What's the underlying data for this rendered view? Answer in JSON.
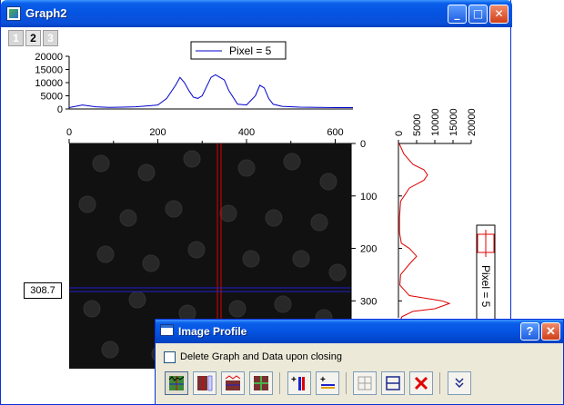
{
  "window": {
    "title": "Graph2",
    "controls": {
      "minimize": "minimize-icon",
      "maximize": "maximize-icon",
      "close": "close-icon"
    },
    "layer_tabs": [
      "1",
      "2",
      "3"
    ],
    "active_layer": "2"
  },
  "legend": {
    "label": "Pixel = 5"
  },
  "vertical_legend": {
    "label": "Pixel = 5"
  },
  "readout": {
    "value": "308.7"
  },
  "dialog": {
    "title": "Image Profile",
    "help_label": "?",
    "checkbox_label": "Delete Graph and Data upon closing",
    "checkbox_checked": false,
    "tools": [
      "horizontal-vertical-profile-icon",
      "vertical-profile-icon",
      "horizontal-profile-icon",
      "crosshair-profile-icon",
      "add-vertical-line-icon",
      "add-horizontal-line-icon",
      "arbitrary-line-icon",
      "horizontal-bar-icon",
      "delete-line-icon",
      "expand-chevron-icon"
    ]
  },
  "colors": {
    "profile_line": "#0000cc",
    "side_profile": "#e00000",
    "cursor_vertical": "#e00000",
    "cursor_horizontal": "#2020d0",
    "image_background": "#111111"
  },
  "chart_data": [
    {
      "type": "line",
      "name": "horizontal-profile",
      "series": [
        {
          "name": "Pixel = 5"
        }
      ],
      "xlim": [
        0,
        640
      ],
      "ylim": [
        0,
        20000
      ],
      "x_ticks": [
        "0",
        "200",
        "400",
        "600"
      ],
      "y_ticks": [
        "0",
        "5000",
        "10000",
        "15000",
        "20000"
      ],
      "x": [
        0,
        30,
        60,
        90,
        120,
        150,
        180,
        200,
        220,
        240,
        250,
        260,
        270,
        280,
        290,
        300,
        320,
        330,
        340,
        350,
        360,
        380,
        400,
        420,
        430,
        440,
        450,
        460,
        480,
        520,
        560,
        600,
        640
      ],
      "y": [
        500,
        1500,
        800,
        600,
        700,
        800,
        1200,
        1500,
        4000,
        9000,
        12000,
        10000,
        7000,
        4500,
        4000,
        5000,
        12000,
        13000,
        12000,
        11000,
        7000,
        1800,
        1500,
        5000,
        9000,
        8000,
        4000,
        1800,
        1000,
        700,
        600,
        500,
        500
      ]
    },
    {
      "type": "line",
      "name": "vertical-profile",
      "series": [
        {
          "name": "Pixel = 5"
        }
      ],
      "xlim": [
        0,
        20000
      ],
      "ylim": [
        0,
        360
      ],
      "x_ticks": [
        "0",
        "5000",
        "10000",
        "15000",
        "20000"
      ],
      "y_ticks": [
        "0",
        "100",
        "200",
        "300"
      ],
      "x": [
        200,
        1500,
        4000,
        7000,
        8000,
        7000,
        3000,
        600,
        300,
        300,
        800,
        3000,
        5000,
        3000,
        600,
        400,
        3000,
        12000,
        14000,
        10000,
        4000,
        1000,
        300,
        200,
        200
      ],
      "y": [
        0,
        20,
        40,
        50,
        60,
        70,
        85,
        110,
        140,
        170,
        190,
        200,
        215,
        230,
        250,
        270,
        290,
        300,
        305,
        315,
        320,
        330,
        340,
        350,
        360
      ]
    }
  ]
}
